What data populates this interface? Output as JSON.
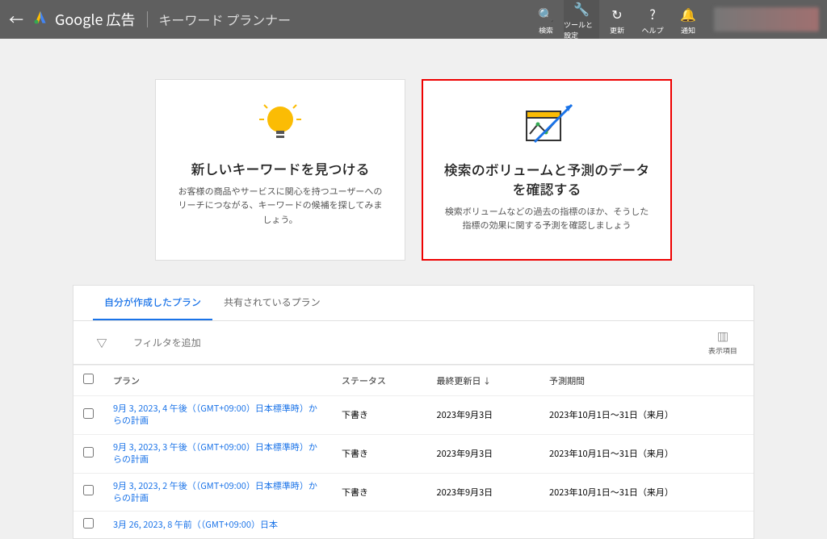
{
  "header": {
    "logo_text": "Google 広告",
    "page_title": "キーワード プランナー",
    "items": {
      "search": "検索",
      "tools": "ツールと設定",
      "refresh": "更新",
      "help": "ヘルプ",
      "notifications": "通知"
    }
  },
  "cards": {
    "find": {
      "title": "新しいキーワードを見つける",
      "desc": "お客様の商品やサービスに関心を持つユーザーへのリーチにつながる、キーワードの候補を探してみましょう。"
    },
    "volume": {
      "title": "検索のボリュームと予測のデータを確認する",
      "desc": "検索ボリュームなどの過去の指標のほか、そうした指標の効果に関する予測を確認しましょう"
    }
  },
  "plans": {
    "tabs": {
      "mine": "自分が作成したプラン",
      "shared": "共有されているプラン"
    },
    "add_filter": "フィルタを追加",
    "columns_label": "表示項目",
    "cols": {
      "plan": "プラン",
      "status": "ステータス",
      "updated": "最終更新日",
      "forecast": "予測期間"
    },
    "rows": [
      {
        "name": "9月 3, 2023, 4 午後（（GMT+09:00）日本標準時）からの計画",
        "status": "下書き",
        "updated": "2023年9月3日",
        "forecast": "2023年10月1日～31日（来月）"
      },
      {
        "name": "9月 3, 2023, 3 午後（（GMT+09:00）日本標準時）からの計画",
        "status": "下書き",
        "updated": "2023年9月3日",
        "forecast": "2023年10月1日～31日（来月）"
      },
      {
        "name": "9月 3, 2023, 2 午後（（GMT+09:00）日本標準時）からの計画",
        "status": "下書き",
        "updated": "2023年9月3日",
        "forecast": "2023年10月1日～31日（来月）"
      },
      {
        "name": "3月 26, 2023, 8 午前（（GMT+09:00）日本",
        "status": "",
        "updated": "",
        "forecast": ""
      }
    ]
  }
}
